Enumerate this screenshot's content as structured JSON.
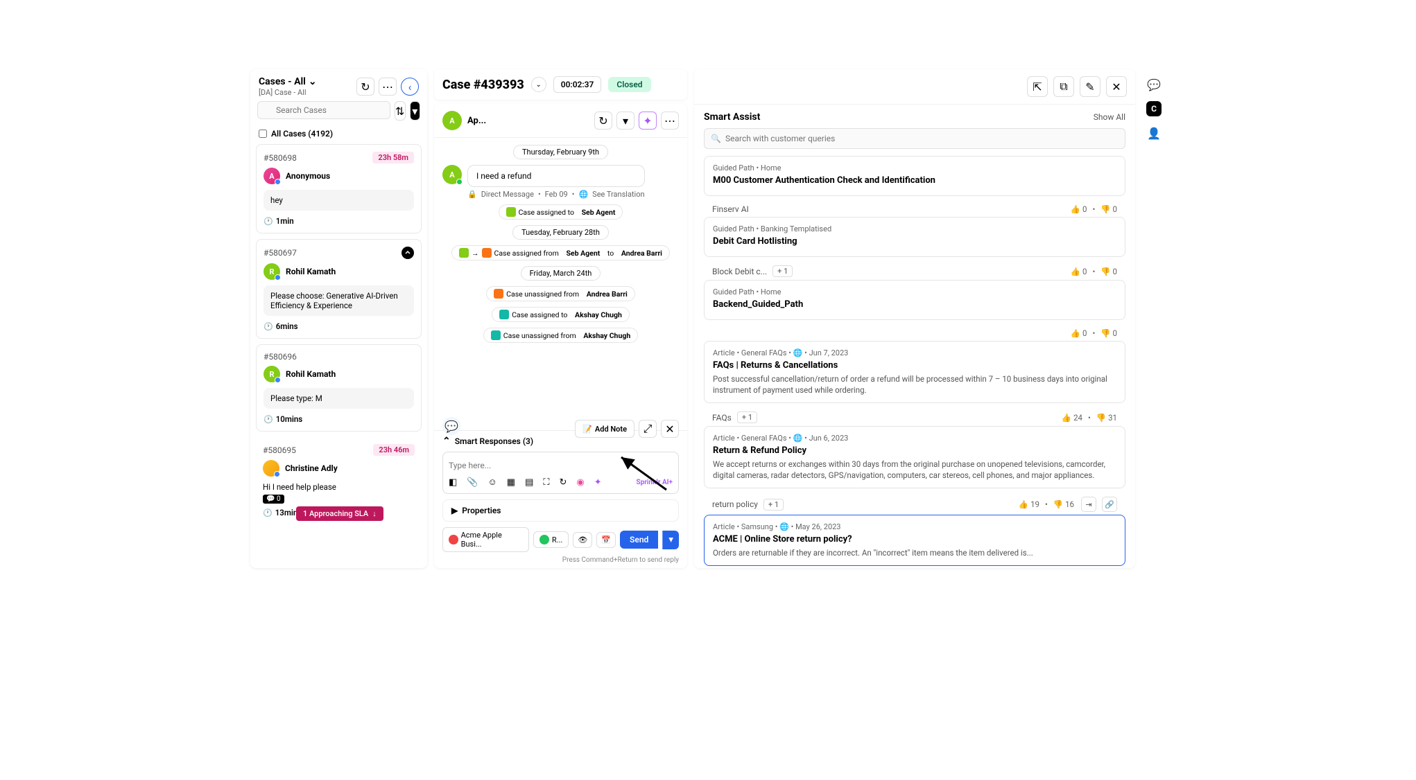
{
  "sidebar": {
    "title": "Cases - All",
    "subtitle": "[DA] Case - All",
    "search_placeholder": "Search Cases",
    "all_cases_label": "All Cases (4192)",
    "approaching_sla": "1 Approaching SLA",
    "cases": [
      {
        "id": "#580698",
        "badge": "23h 58m",
        "user": "Anonymous",
        "avatar_letter": "A",
        "avatar_class": "pink",
        "msg": "hey",
        "time": "1min"
      },
      {
        "id": "#580697",
        "user": "Rohil Kamath",
        "avatar_letter": "R",
        "avatar_class": "green",
        "msg": "Please choose: Generative AI-Driven Efficiency & Experience",
        "time": "6mins",
        "right_badge": "dark"
      },
      {
        "id": "#580696",
        "user": "Rohil Kamath",
        "avatar_letter": "R",
        "avatar_class": "green",
        "msg": "Please type: M",
        "time": "10mins"
      },
      {
        "id": "#580695",
        "badge": "23h 46m",
        "user": "Christine Adly",
        "avatar_img": true,
        "msg_plain": "Hi I need help please",
        "sub_badge": "0",
        "time": "13mins"
      }
    ]
  },
  "conversation": {
    "case_title": "Case #439393",
    "timer": "00:02:37",
    "status": "Closed",
    "header_user_letter": "A",
    "header_user_name": "Ap...",
    "add_note_label": "Add Note",
    "smart_responses_label": "Smart Responses (3)",
    "compose_placeholder": "Type here...",
    "properties_label": "Properties",
    "account_chip": "Acme Apple Busi...",
    "reply_chip": "R...",
    "send_label": "Send",
    "send_hint": "Press Command+Return to send reply",
    "sprinklr_ai": "Sprinklr AI+",
    "thread": [
      {
        "type": "date",
        "text": "Thursday, February 9th"
      },
      {
        "type": "msg",
        "avatar_letter": "A",
        "text": "I need a refund",
        "meta_prefix": "Direct Message",
        "meta_date": "Feb 09",
        "meta_translate": "See Translation"
      },
      {
        "type": "sys",
        "avatar_class": "green",
        "prefix": "Case assigned to",
        "bold": "Seb Agent"
      },
      {
        "type": "date",
        "text": "Tuesday, February 28th"
      },
      {
        "type": "sys_transfer",
        "prefix": "Case assigned from",
        "from": "Seb Agent",
        "to_label": "to",
        "to": "Andrea Barri"
      },
      {
        "type": "date",
        "text": "Friday, March 24th"
      },
      {
        "type": "sys",
        "avatar_class": "orange",
        "prefix": "Case unassigned from",
        "bold": "Andrea Barri"
      },
      {
        "type": "sys",
        "avatar_class": "teal",
        "prefix": "Case assigned to",
        "bold": "Akshay Chugh"
      },
      {
        "type": "sys",
        "avatar_class": "teal",
        "prefix": "Case unassigned from",
        "bold": "Akshay Chugh"
      }
    ]
  },
  "assist": {
    "title": "Smart Assist",
    "show_all": "Show All",
    "search_placeholder": "Search with customer queries",
    "items": [
      {
        "meta": "Guided Path  •  Home",
        "title": "M00 Customer Authentication Check and Identification",
        "footer_left": "Finserv AI",
        "up": "0",
        "down": "0"
      },
      {
        "meta": "Guided Path  •  Banking Templatised",
        "title": "Debit Card Hotlisting",
        "footer_left": "Block Debit c...",
        "plus": "+ 1",
        "up": "0",
        "down": "0"
      },
      {
        "meta": "Guided Path  •  Home",
        "title": "Backend_Guided_Path",
        "footer_left": "",
        "up": "0",
        "down": "0"
      },
      {
        "meta": "Article  •  General FAQs  •  🌐  •  Jun 7, 2023",
        "title": "FAQs | Returns & Cancellations",
        "body": "Post successful cancellation/return of order a refund will be processed within 7 – 10 business days into original instrument of payment used while ordering.",
        "footer_left": "FAQs",
        "plus": "+ 1",
        "up": "24",
        "down": "31"
      },
      {
        "meta": "Article  •  General FAQs  •  🌐  •  Jun 6, 2023",
        "title": "Return & Refund Policy",
        "body": "We accept returns or exchanges within 30 days from the original purchase on unopened televisions, camcorder, digital cameras, radar detectors, GPS/navigation, computers, car stereos, cell phones, and major appliances.",
        "footer_left": "return policy",
        "plus": "+ 1",
        "up": "19",
        "down": "16",
        "footer_icons": true
      },
      {
        "meta": "Article  •  Samsung  •  🌐  •  May 26, 2023",
        "title": "ACME | Online Store return policy?",
        "body": "Orders are returnable if they are incorrect. An \"incorrect\" item means the item delivered is...",
        "blue_border": true
      }
    ]
  }
}
